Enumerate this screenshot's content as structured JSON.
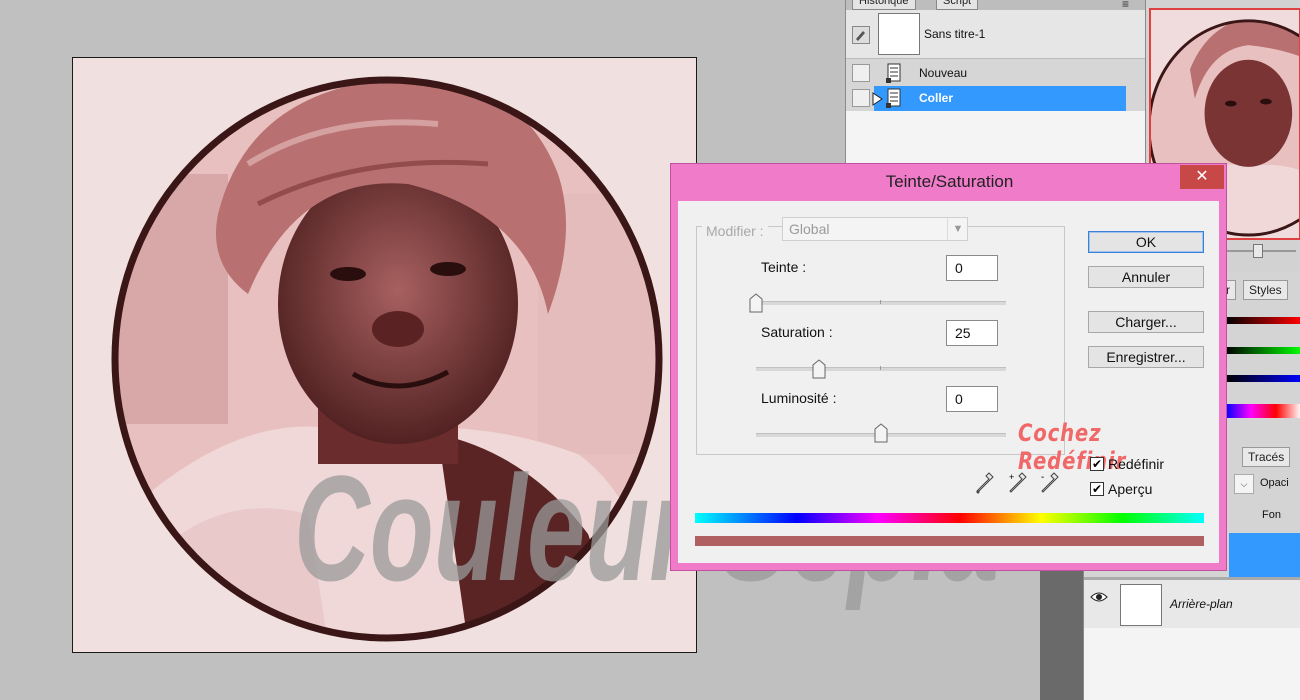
{
  "history_panel": {
    "tabs": [
      "Historique",
      "Script"
    ],
    "snapshot_label": "Sans titre-1",
    "items": [
      {
        "label": "Nouveau",
        "selected": false
      },
      {
        "label": "Coller",
        "selected": true
      }
    ]
  },
  "right_panels": {
    "mid_tabs": [
      "r",
      "Styles"
    ],
    "layer_tabs": [
      "Tracés"
    ],
    "opacity_label": "Opaci",
    "fill_label": "Fon",
    "layer_name": "Arrière-plan"
  },
  "dialog": {
    "title": "Teinte/Saturation",
    "close_glyph": "✕",
    "modifier_label": "Modifier :",
    "modifier_value": "Global",
    "teinte_label": "Teinte :",
    "teinte_value": "0",
    "saturation_label": "Saturation :",
    "saturation_value": "25",
    "luminosite_label": "Luminosité :",
    "luminosite_value": "0",
    "buttons": {
      "ok": "OK",
      "annuler": "Annuler",
      "charger": "Charger...",
      "enregistrer": "Enregistrer..."
    },
    "redefinir_label": "Redéfinir",
    "apercu_label": "Aperçu",
    "check_glyph": "✔",
    "redefinir_checked": true,
    "apercu_checked": true,
    "slider_levels": {
      "teinte": 0,
      "saturation": 25,
      "luminosite": 0
    },
    "colorize_color": "#b06060"
  },
  "annotation": "Cochez Redéfinir",
  "watermark": "Couleur Sepia",
  "colors": {
    "sepia_tint": "#7a3a3a",
    "dialog_frame": "#f07bc8",
    "selection_blue": "#3399ff",
    "annotation": "#f06868"
  }
}
